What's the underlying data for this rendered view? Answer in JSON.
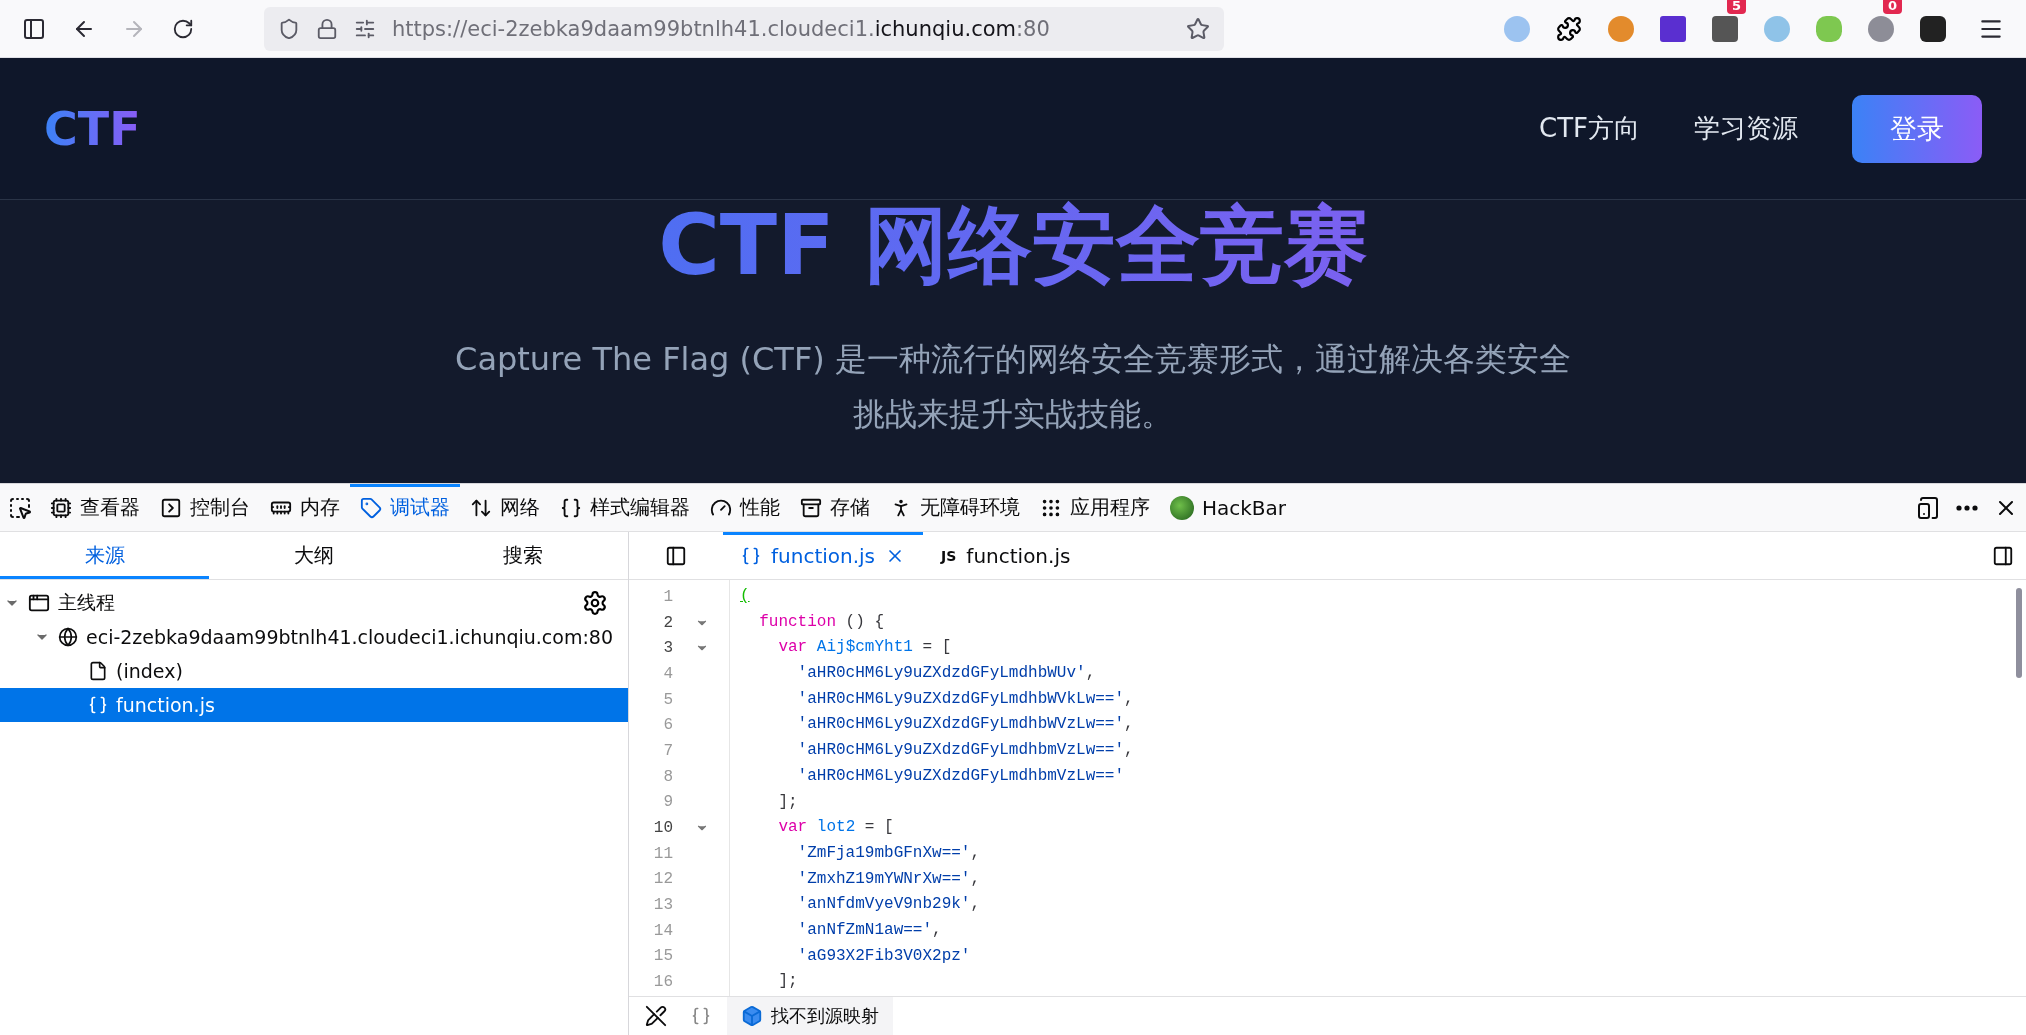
{
  "browser": {
    "url": {
      "prefix": "https://eci-2zebka9daam99btnlh41.cloudeci1.",
      "domain": "ichunqiu.com",
      "suffix": ":80"
    },
    "forward_disabled": true,
    "extension_badges": [
      "5",
      "0"
    ]
  },
  "page": {
    "logo": "CTF",
    "nav": [
      "CTF方向",
      "学习资源"
    ],
    "login": "登录",
    "hero_title": "CTF 网络安全竞赛",
    "hero_text": "Capture The Flag (CTF) 是一种流行的网络安全竞赛形式，通过解决各类安全挑战来提升实战技能。"
  },
  "devtools": {
    "tabs": [
      {
        "label": "查看器",
        "selected": false
      },
      {
        "label": "控制台",
        "selected": false
      },
      {
        "label": "内存",
        "selected": false
      },
      {
        "label": "调试器",
        "selected": true
      },
      {
        "label": "网络",
        "selected": false
      },
      {
        "label": "样式编辑器",
        "selected": false
      },
      {
        "label": "性能",
        "selected": false
      },
      {
        "label": "存储",
        "selected": false
      },
      {
        "label": "无障碍环境",
        "selected": false
      },
      {
        "label": "应用程序",
        "selected": false
      },
      {
        "label": "HackBar",
        "selected": false
      }
    ],
    "side_tabs": [
      {
        "label": "来源",
        "selected": true
      },
      {
        "label": "大纲",
        "selected": false
      },
      {
        "label": "搜索",
        "selected": false
      }
    ],
    "tree": [
      {
        "label": "主线程",
        "kind": "thread",
        "expanded": true,
        "selected": false,
        "children": [
          {
            "label": "eci-2zebka9daam99btnlh41.cloudeci1.ichunqiu.com:80",
            "kind": "host",
            "expanded": true,
            "selected": false,
            "children": [
              {
                "label": "(index)",
                "kind": "file",
                "selected": false
              },
              {
                "label": "function.js",
                "kind": "script",
                "selected": true
              }
            ]
          }
        ]
      }
    ],
    "editor_tabs": [
      {
        "label": "function.js",
        "kind": "pretty",
        "selected": true
      },
      {
        "label": "function.js",
        "badge": "JS",
        "kind": "source",
        "selected": false
      }
    ],
    "code_lines": [
      {
        "number": "1",
        "foldable": false,
        "tokens": [
          {
            "kind": "match",
            "text": "("
          }
        ]
      },
      {
        "number": "2",
        "foldable": true,
        "tokens": [
          {
            "kind": "keyword",
            "text": "  function"
          },
          {
            "kind": "punct",
            "text": " () {"
          }
        ]
      },
      {
        "number": "3",
        "foldable": true,
        "tokens": [
          {
            "kind": "keyword",
            "text": "    var"
          },
          {
            "kind": "ident",
            "text": " Aij$cmYht1"
          },
          {
            "kind": "punct",
            "text": " = ["
          }
        ]
      },
      {
        "number": "4",
        "foldable": false,
        "tokens": [
          {
            "kind": "string",
            "text": "      'aHR0cHM6Ly9uZXdzdGFyLmdhbWUv'"
          },
          {
            "kind": "punct",
            "text": ","
          }
        ]
      },
      {
        "number": "5",
        "foldable": false,
        "tokens": [
          {
            "kind": "string",
            "text": "      'aHR0cHM6Ly9uZXdzdGFyLmdhbWVkLw=='"
          },
          {
            "kind": "punct",
            "text": ","
          }
        ]
      },
      {
        "number": "6",
        "foldable": false,
        "tokens": [
          {
            "kind": "string",
            "text": "      'aHR0cHM6Ly9uZXdzdGFyLmdhbWVzLw=='"
          },
          {
            "kind": "punct",
            "text": ","
          }
        ]
      },
      {
        "number": "7",
        "foldable": false,
        "tokens": [
          {
            "kind": "string",
            "text": "      'aHR0cHM6Ly9uZXdzdGFyLmdhbmVzLw=='"
          },
          {
            "kind": "punct",
            "text": ","
          }
        ]
      },
      {
        "number": "8",
        "foldable": false,
        "tokens": [
          {
            "kind": "string",
            "text": "      'aHR0cHM6Ly9uZXdzdGFyLmdhbmVzLw=='"
          }
        ]
      },
      {
        "number": "9",
        "foldable": false,
        "tokens": [
          {
            "kind": "punct",
            "text": "    ];"
          }
        ]
      },
      {
        "number": "10",
        "foldable": true,
        "tokens": [
          {
            "kind": "keyword",
            "text": "    var"
          },
          {
            "kind": "ident",
            "text": " lot2"
          },
          {
            "kind": "punct",
            "text": " = ["
          }
        ]
      },
      {
        "number": "11",
        "foldable": false,
        "tokens": [
          {
            "kind": "string",
            "text": "      'ZmFja19mbGFnXw=='"
          },
          {
            "kind": "punct",
            "text": ","
          }
        ]
      },
      {
        "number": "12",
        "foldable": false,
        "tokens": [
          {
            "kind": "string",
            "text": "      'ZmxhZ19mYWNrXw=='"
          },
          {
            "kind": "punct",
            "text": ","
          }
        ]
      },
      {
        "number": "13",
        "foldable": false,
        "tokens": [
          {
            "kind": "string",
            "text": "      'anNfdmVyeV9nb29k'"
          },
          {
            "kind": "punct",
            "text": ","
          }
        ]
      },
      {
        "number": "14",
        "foldable": false,
        "tokens": [
          {
            "kind": "string",
            "text": "      'anNfZmN1aw=='"
          },
          {
            "kind": "punct",
            "text": ","
          }
        ]
      },
      {
        "number": "15",
        "foldable": false,
        "tokens": [
          {
            "kind": "string",
            "text": "      'aG93X2Fib3V0X2pz'"
          }
        ]
      },
      {
        "number": "16",
        "foldable": false,
        "tokens": [
          {
            "kind": "punct",
            "text": "    ];"
          }
        ]
      }
    ],
    "footer_status": "找不到源映射"
  }
}
